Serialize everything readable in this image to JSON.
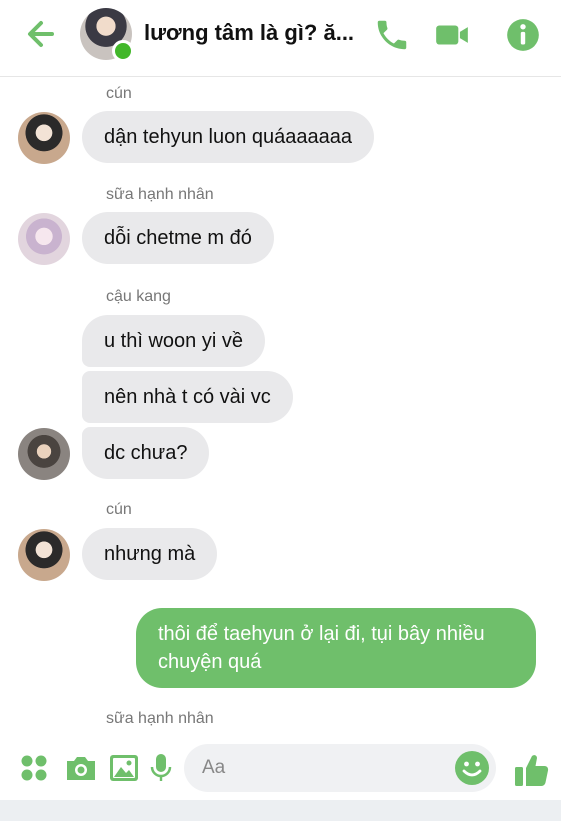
{
  "header": {
    "title": "lương tâm là gì? ă...",
    "back_icon": "arrow-left-icon",
    "call_icon": "phone-icon",
    "video_icon": "video-camera-icon",
    "info_icon": "info-icon",
    "accent_color": "#6fbf6b"
  },
  "messages": [
    {
      "sender": "cún",
      "text": "dận tehyun luon quáaaaaaa"
    },
    {
      "sender": "sữa hạnh nhân",
      "text": "dỗi chetme m đó"
    },
    {
      "sender": "cậu kang",
      "texts": [
        "u thì woon yi về",
        "nên nhà t có vài vc",
        "dc chưa?"
      ]
    },
    {
      "sender": "cún",
      "text": "nhưng mà"
    },
    {
      "outgoing": true,
      "text": "thôi để taehyun ở lại đi, tụi bây nhiều chuyện quá"
    },
    {
      "sender": "sữa hạnh nhân",
      "typing_label": ""
    }
  ],
  "composer": {
    "placeholder": "Aa",
    "apps_icon": "apps-grid-icon",
    "camera_icon": "camera-icon",
    "image_icon": "image-icon",
    "mic_icon": "microphone-icon",
    "emoji_icon": "emoji-icon",
    "like_icon": "thumbs-up-icon"
  }
}
